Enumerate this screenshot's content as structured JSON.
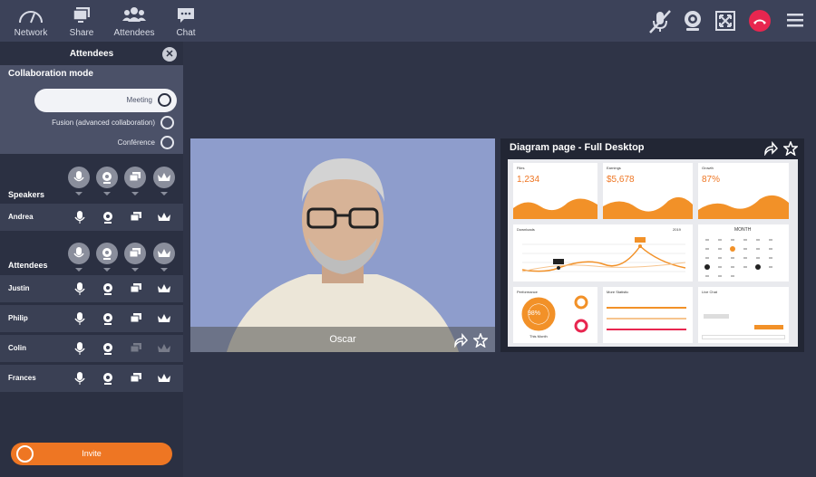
{
  "toolbar": {
    "network": "Network",
    "share": "Share",
    "attendees": "Attendees",
    "chat": "Chat"
  },
  "panel": {
    "title": "Attendees",
    "collab_title": "Collaboration mode",
    "modes": [
      "Meeting",
      "Fusion (advanced collaboration)",
      "Conférence"
    ],
    "selected_mode": "Meeting",
    "speakers_label": "Speakers",
    "attendees_label": "Attendees",
    "speakers": [
      "Andrea"
    ],
    "attendees": [
      "Justin",
      "Philip",
      "Colin",
      "Frances"
    ],
    "invite": "Invite"
  },
  "video": {
    "name": "Oscar"
  },
  "shared": {
    "title": "Diagram page - Full Desktop",
    "cards": {
      "files_label": "Files",
      "files_value": "1,234",
      "earnings_label": "Earnings",
      "earnings_value": "$5,678",
      "growth_label": "Growth",
      "growth_value": "87%",
      "downloads_label": "Downloads",
      "downloads_year": "2019",
      "month_label": "MONTH",
      "performance_label": "Performance",
      "performance_value": "98%",
      "this_month": "This Month",
      "more_statistic": "More Statistic",
      "live_chat": "Live Chat"
    }
  },
  "colors": {
    "accent": "#ee7623",
    "hangup": "#e8264f",
    "topbar": "#3c4259"
  }
}
